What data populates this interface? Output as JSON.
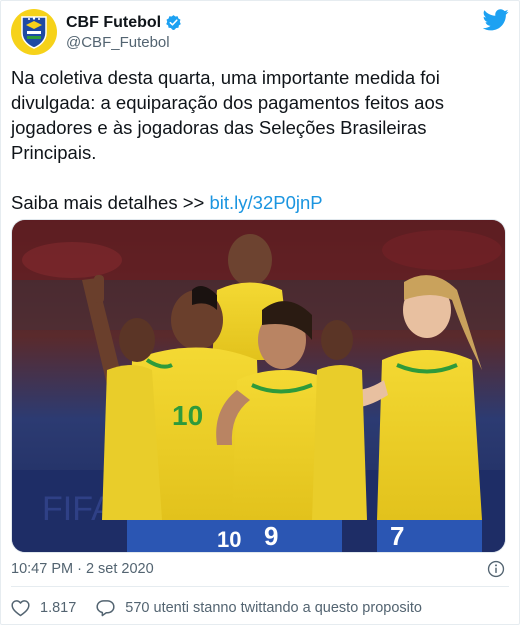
{
  "account": {
    "name": "CBF Futebol",
    "handle": "@CBF_Futebol"
  },
  "tweet": {
    "paragraph1": "Na coletiva desta quarta, uma importante medida foi divulgada: a equiparação dos pagamentos feitos aos jogadores e às jogadoras das Seleções Brasileiras Principais.",
    "more_prefix": "Saiba mais detalhes >> ",
    "link_text": "bit.ly/32P0jnP"
  },
  "meta": {
    "timestamp": "10:47 PM · 2 set 2020"
  },
  "actions": {
    "like_count": "1.817",
    "conversation_text": "570 utenti stanno twittando a questo proposito"
  },
  "photo": {
    "jersey_numbers": [
      "10",
      "10",
      "9",
      "7"
    ]
  },
  "icons": {
    "avatar": "cbf-crest-icon",
    "verified": "verified-badge-icon",
    "brand": "twitter-bird-icon",
    "info": "info-icon",
    "like": "heart-icon",
    "reply": "speech-bubble-icon"
  },
  "colors": {
    "link": "#1b95e0",
    "verified": "#1da1f2",
    "avatar_bg": "#f6d21a",
    "crest": "#1f4aa3",
    "secondary_text": "#536471"
  }
}
